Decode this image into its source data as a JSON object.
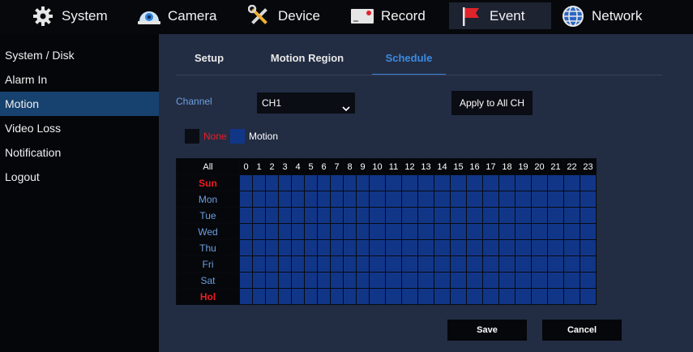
{
  "nav": {
    "items": [
      {
        "label": "System",
        "icon": "gear-icon"
      },
      {
        "label": "Camera",
        "icon": "camera-icon"
      },
      {
        "label": "Device",
        "icon": "tools-icon"
      },
      {
        "label": "Record",
        "icon": "record-icon"
      },
      {
        "label": "Event",
        "icon": "flag-icon"
      },
      {
        "label": "Network",
        "icon": "globe-icon"
      }
    ],
    "active": "Event"
  },
  "sidebar": {
    "items": [
      {
        "label": "System / Disk"
      },
      {
        "label": "Alarm In"
      },
      {
        "label": "Motion"
      },
      {
        "label": "Video Loss"
      },
      {
        "label": "Notification"
      },
      {
        "label": "Logout"
      }
    ],
    "active": "Motion"
  },
  "tabs": {
    "items": [
      {
        "label": "Setup"
      },
      {
        "label": "Motion Region"
      },
      {
        "label": "Schedule"
      }
    ],
    "active": "Schedule"
  },
  "channel": {
    "label": "Channel",
    "value": "CH1"
  },
  "apply_label": "Apply to All CH",
  "legend": {
    "none_label": "None",
    "motion_label": "Motion",
    "none_color": "#0a0d14",
    "motion_color": "#113688"
  },
  "schedule": {
    "all_label": "All",
    "hours": [
      "0",
      "1",
      "2",
      "3",
      "4",
      "5",
      "6",
      "7",
      "8",
      "9",
      "10",
      "11",
      "12",
      "13",
      "14",
      "15",
      "16",
      "17",
      "18",
      "19",
      "20",
      "21",
      "22",
      "23"
    ],
    "days": [
      {
        "label": "Sun",
        "highlight": true
      },
      {
        "label": "Mon",
        "highlight": false
      },
      {
        "label": "Tue",
        "highlight": false
      },
      {
        "label": "Wed",
        "highlight": false
      },
      {
        "label": "Thu",
        "highlight": false
      },
      {
        "label": "Fri",
        "highlight": false
      },
      {
        "label": "Sat",
        "highlight": false
      },
      {
        "label": "Hol",
        "highlight": true
      }
    ],
    "all_cells_state": "Motion"
  },
  "buttons": {
    "save_label": "Save",
    "cancel_label": "Cancel"
  },
  "colors": {
    "accent": "#3d8ae0",
    "active_sidebar": "#17416e",
    "cell_motion": "#113688",
    "holiday_red": "#ee1d23"
  }
}
